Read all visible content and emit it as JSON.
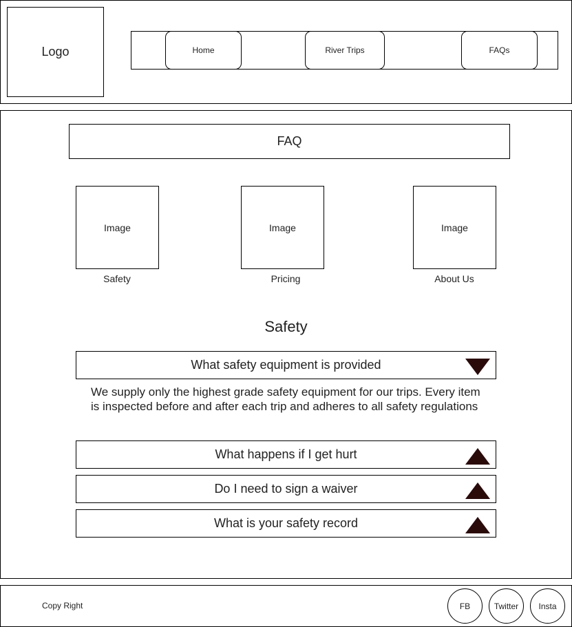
{
  "header": {
    "logo": "Logo",
    "nav": {
      "home": "Home",
      "river_trips": "River Trips",
      "faqs": "FAQs"
    }
  },
  "main": {
    "banner": "FAQ",
    "categories": [
      {
        "image": "Image",
        "label": "Safety"
      },
      {
        "image": "Image",
        "label": "Pricing"
      },
      {
        "image": "Image",
        "label": "About Us"
      }
    ],
    "section_title": "Safety",
    "faqs": [
      {
        "question": "What safety equipment is provided",
        "expanded": true,
        "answer": "We supply only the highest grade safety equipment for our trips. Every item is inspected before and after each trip and adheres to all safety regulations"
      },
      {
        "question": "What happens if I get hurt",
        "expanded": false
      },
      {
        "question": "Do I need to sign a waiver",
        "expanded": false
      },
      {
        "question": "What is your safety record",
        "expanded": false
      }
    ]
  },
  "footer": {
    "copyright": "Copy Right",
    "social": {
      "fb": "FB",
      "twitter": "Twitter",
      "insta": "Insta"
    }
  },
  "icons": {
    "collapse": "triangle-down-icon",
    "expand": "triangle-up-icon"
  },
  "colors": {
    "toggle_icon": "#2b0a0a"
  }
}
